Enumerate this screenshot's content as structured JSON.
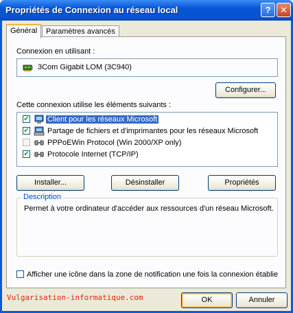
{
  "window": {
    "title": "Propriétés de Connexion au réseau local",
    "help_glyph": "?",
    "close_glyph": "✕"
  },
  "tabs": [
    {
      "label": "Général",
      "active": true
    },
    {
      "label": "Paramètres avancés",
      "active": false
    }
  ],
  "general": {
    "connect_using_label": "Connexion en utilisant :",
    "adapter_name": "3Com Gigabit LOM (3C940)",
    "adapter_icon": "network-card-icon",
    "configure_button": "Configurer...",
    "components_label": "Cette connexion utilise les éléments suivants :",
    "components": [
      {
        "label": "Client pour les réseaux Microsoft",
        "checked": true,
        "selected": true,
        "icon": "computer-network-icon"
      },
      {
        "label": "Partage de fichiers et d'imprimantes pour les réseaux Microsoft",
        "checked": true,
        "selected": false,
        "icon": "printer-share-icon"
      },
      {
        "label": "PPPoEWin Protocol (Win 2000/XP only)",
        "checked": false,
        "selected": false,
        "icon": "protocol-icon"
      },
      {
        "label": "Protocole Internet (TCP/IP)",
        "checked": true,
        "selected": false,
        "icon": "protocol-icon"
      }
    ],
    "install_button": "Installer...",
    "uninstall_button": "Désinstaller",
    "properties_button": "Propriétés",
    "description_title": "Description",
    "description_text": "Permet à votre ordinateur d'accéder aux ressources d'un réseau Microsoft.",
    "notify_checkbox_label": "Afficher une icône dans la zone de notification une fois la connexion établie",
    "notify_checked": false
  },
  "footer": {
    "watermark": "Vulgarisation-informatique.com",
    "ok_button": "OK",
    "cancel_button": "Annuler"
  },
  "colors": {
    "titlebar": "#0653d2",
    "selection": "#316ac5",
    "watermark": "#e8210c"
  }
}
